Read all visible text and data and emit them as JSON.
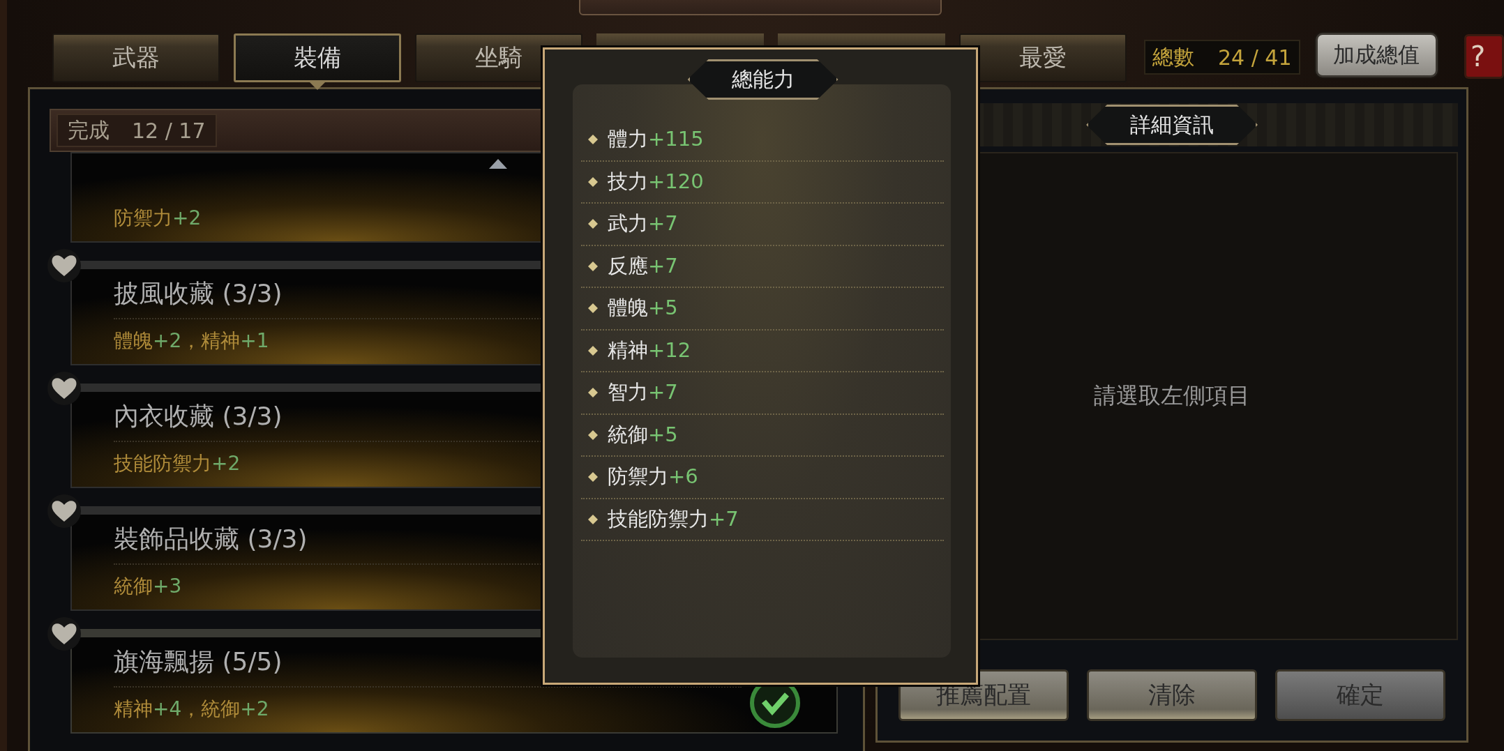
{
  "tabs": [
    {
      "label": "武器",
      "selected": false
    },
    {
      "label": "裝備",
      "selected": true
    },
    {
      "label": "坐騎",
      "selected": false
    },
    {
      "kind": "hidden",
      "selected": false
    },
    {
      "kind": "hidden",
      "selected": false
    },
    {
      "label": "最愛",
      "selected": false
    }
  ],
  "total": {
    "label": "總數",
    "value": "24 / 41"
  },
  "bonus_button": "加成總值",
  "help_button": "?",
  "progress": {
    "label": "完成",
    "value": "12 / 17"
  },
  "collections": [
    {
      "bonus": [
        {
          "kind": "stat",
          "text": "防禦力"
        },
        {
          "kind": "value",
          "text": "+2"
        }
      ],
      "completed": false
    },
    {
      "title": "披風收藏 (3/3)",
      "bonus": [
        {
          "kind": "stat",
          "text": "體魄"
        },
        {
          "kind": "value",
          "text": "+2"
        },
        {
          "kind": "stat",
          "text": "，精神"
        },
        {
          "kind": "value",
          "text": "+1"
        }
      ],
      "completed": false
    },
    {
      "title": "內衣收藏 (3/3)",
      "bonus": [
        {
          "kind": "stat",
          "text": "技能防禦力"
        },
        {
          "kind": "value",
          "text": "+2"
        }
      ],
      "completed": false
    },
    {
      "title": "裝飾品收藏 (3/3)",
      "bonus": [
        {
          "kind": "stat",
          "text": "統御"
        },
        {
          "kind": "value",
          "text": "+3"
        }
      ],
      "completed": false
    },
    {
      "title": "旗海飄揚 (5/5)",
      "bonus": [
        {
          "kind": "stat",
          "text": "精神"
        },
        {
          "kind": "value",
          "text": "+4"
        },
        {
          "kind": "stat",
          "text": "，統御"
        },
        {
          "kind": "value",
          "text": "+2"
        }
      ],
      "completed": true
    }
  ],
  "popup": {
    "title": "總能力",
    "stats": [
      {
        "name": "體力",
        "value": "+115"
      },
      {
        "name": "技力",
        "value": "+120"
      },
      {
        "name": "武力",
        "value": "+7"
      },
      {
        "name": "反應",
        "value": "+7"
      },
      {
        "name": "體魄",
        "value": "+5"
      },
      {
        "name": "精神",
        "value": "+12"
      },
      {
        "name": "智力",
        "value": "+7"
      },
      {
        "name": "統御",
        "value": "+5"
      },
      {
        "name": "防禦力",
        "value": "+6"
      },
      {
        "name": "技能防禦力",
        "value": "+7"
      }
    ]
  },
  "detail": {
    "title": "詳細資訊",
    "message": "請選取左側項目"
  },
  "actions": [
    {
      "label": "推薦配置",
      "kind": "light"
    },
    {
      "label": "清除",
      "kind": "light"
    },
    {
      "label": "確定",
      "kind": "dark"
    }
  ]
}
